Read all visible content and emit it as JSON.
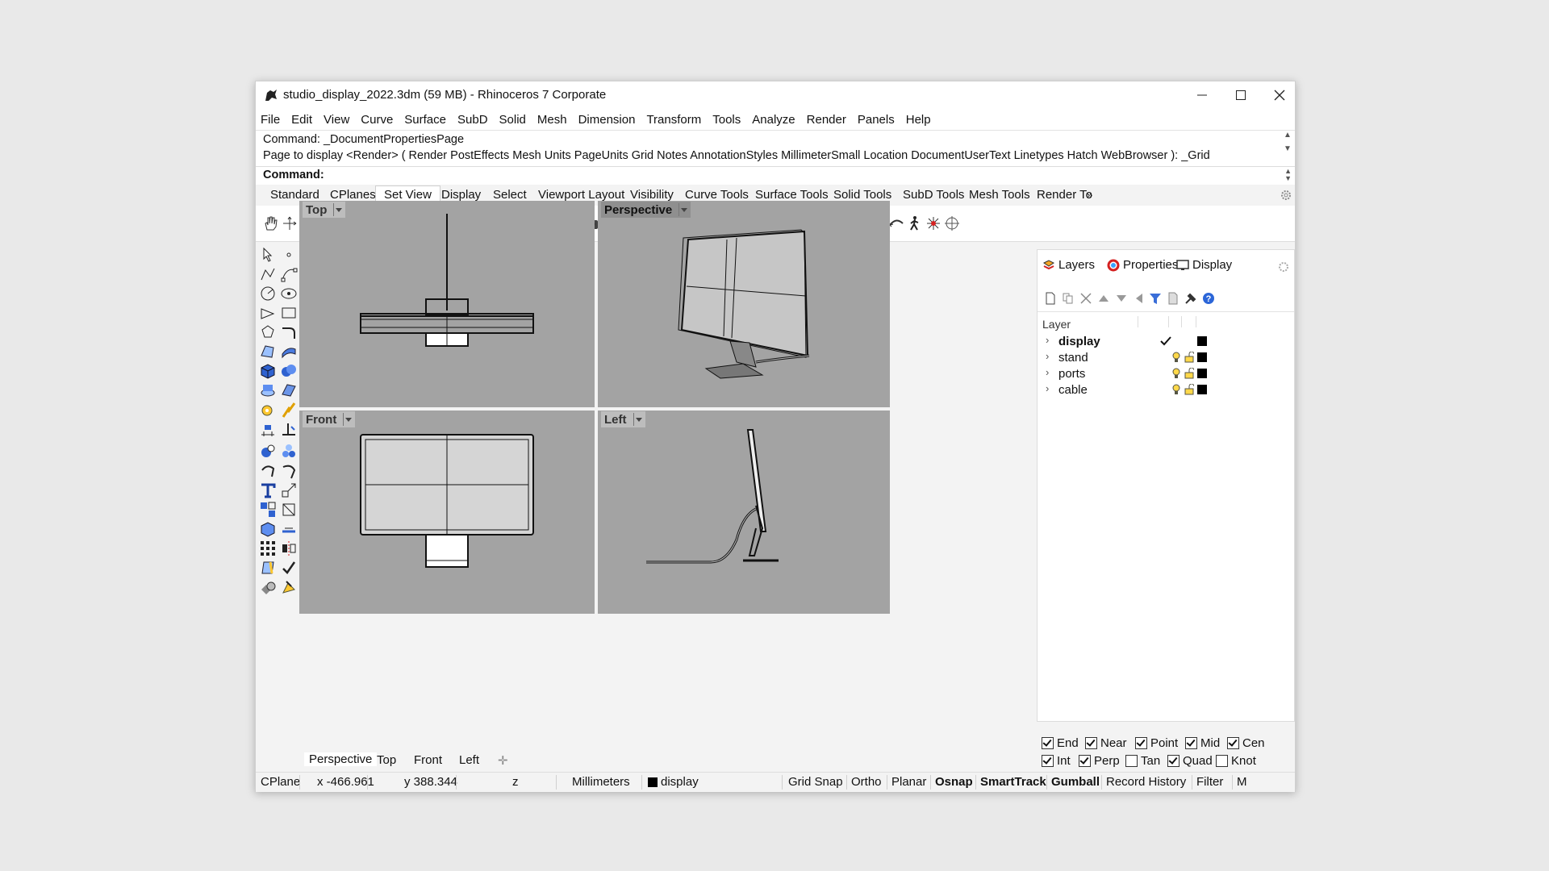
{
  "window": {
    "title": "studio_display_2022.3dm (59 MB) - Rhinoceros 7 Corporate",
    "minimize_icon": "minimize-icon",
    "maximize_icon": "maximize-icon",
    "close_icon": "close-icon"
  },
  "menu": [
    "File",
    "Edit",
    "View",
    "Curve",
    "Surface",
    "SubD",
    "Solid",
    "Mesh",
    "Dimension",
    "Transform",
    "Tools",
    "Analyze",
    "Render",
    "Panels",
    "Help"
  ],
  "command": {
    "history_1": "Command: _DocumentPropertiesPage",
    "history_2": "Page to display <Render> ( Render  PostEffects  Mesh  Units  PageUnits  Grid  Notes  AnnotationStyles  MillimeterSmall  Location  DocumentUserText  Linetypes  Hatch  WebBrowser ): _Grid",
    "prompt": "Command:"
  },
  "toolbar_tabs": [
    "Standard",
    "CPlanes",
    "Set View",
    "Display",
    "Select",
    "Viewport Layout",
    "Visibility",
    "Curve Tools",
    "Surface Tools",
    "Solid Tools",
    "SubD Tools",
    "Mesh Tools",
    "Render To"
  ],
  "toolbar_tabs_active": "Set View",
  "viewports": {
    "top": "Top",
    "perspective": "Perspective",
    "front": "Front",
    "left": "Left"
  },
  "viewport_tabs": [
    "Perspective",
    "Top",
    "Front",
    "Left"
  ],
  "panel": {
    "tabs": [
      "Layers",
      "Properties",
      "Display"
    ],
    "layer_header": "Layer",
    "layers": [
      {
        "name": "display",
        "current": true
      },
      {
        "name": "stand",
        "current": false
      },
      {
        "name": "ports",
        "current": false
      },
      {
        "name": "cable",
        "current": false
      }
    ]
  },
  "osnap": [
    {
      "label": "End",
      "checked": true
    },
    {
      "label": "Near",
      "checked": true
    },
    {
      "label": "Point",
      "checked": true
    },
    {
      "label": "Mid",
      "checked": true
    },
    {
      "label": "Cen",
      "checked": true
    },
    {
      "label": "Int",
      "checked": true
    },
    {
      "label": "Perp",
      "checked": true
    },
    {
      "label": "Tan",
      "checked": false
    },
    {
      "label": "Quad",
      "checked": true
    },
    {
      "label": "Knot",
      "checked": false
    }
  ],
  "status": {
    "cplane": "CPlane",
    "x": "x -466.961",
    "y": "y 388.344",
    "z": "z",
    "units": "Millimeters",
    "layer": "display",
    "grid_snap": "Grid Snap",
    "ortho": "Ortho",
    "planar": "Planar",
    "osnap": "Osnap",
    "smarttrack": "SmartTrack",
    "gumball": "Gumball",
    "record_history": "Record History",
    "filter": "Filter",
    "trail": "M"
  },
  "colors": {
    "viewport_bg": "#a3a3a3",
    "active_label": "#8f8f8f",
    "toolbar_red": "#d42020",
    "help_blue": "#2c66d8"
  }
}
